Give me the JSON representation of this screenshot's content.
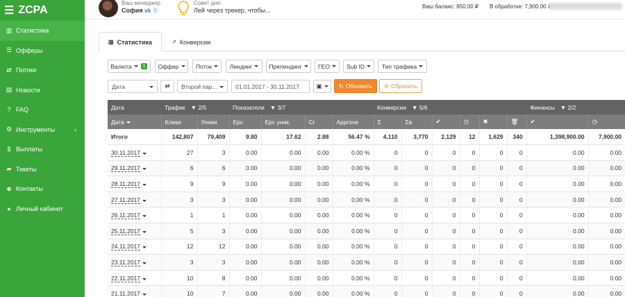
{
  "sidebar": {
    "brand": "ZCPA",
    "items": [
      {
        "label": "Статистика",
        "icon": "bar-chart-icon"
      },
      {
        "label": "Офферы",
        "icon": "list-icon"
      },
      {
        "label": "Потоки",
        "icon": "exchange-icon"
      },
      {
        "label": "Новости",
        "icon": "newspaper-icon"
      },
      {
        "label": "FAQ",
        "icon": "question-icon"
      },
      {
        "label": "Инструменты",
        "icon": "gear-icon"
      },
      {
        "label": "Выплаты",
        "icon": "dollar-icon"
      },
      {
        "label": "Тикеты",
        "icon": "ticket-icon"
      },
      {
        "label": "Контакты",
        "icon": "users-icon"
      },
      {
        "label": "Личный кабинет",
        "icon": "user-icon"
      }
    ]
  },
  "header": {
    "manager_label": "Ваш менеджер",
    "manager_name": "София",
    "advice_label": "Совет дня:",
    "advice_text": "Лей через трекер, чтобы...",
    "balance": "Ваш баланс: 650.00 ₽",
    "processing": "В обработке: 7,900.00 ₽"
  },
  "tabs": [
    {
      "label": "Статистика"
    },
    {
      "label": "Конверсии"
    }
  ],
  "filters": {
    "currency": "Валюта",
    "currency_badge": "1",
    "offer": "Оффер",
    "flows": "Поток",
    "landing": "Лендинг",
    "prelanding": "Прелендинг",
    "geo": "ГЕО",
    "subid": "Sub ID",
    "traffic_type": "Тип трафика",
    "group_primary": "Дата",
    "group_secondary": "Второй пар...",
    "date_range": "01.01.2017 - 30.11.2017",
    "update": "Обновить",
    "reset": "Сбросить"
  },
  "table": {
    "groups": [
      {
        "label": "Дата",
        "count": ""
      },
      {
        "label": "Трафик",
        "count": "2/5"
      },
      {
        "label": "Показатели",
        "count": "3/7"
      },
      {
        "label": "Конверсии",
        "count": "5/6"
      },
      {
        "label": "Финансы",
        "count": "2/2"
      }
    ],
    "columns": [
      "Дата",
      "Клики",
      "Уники",
      "Epc",
      "Epc уник.",
      "Cr",
      "Approve",
      "Σ",
      "Σв",
      "",
      "",
      "",
      "",
      "",
      ""
    ],
    "total": [
      "Итого",
      "142,807",
      "79,409",
      "9.80",
      "17.62",
      "2.88",
      "56.47 %",
      "4,110",
      "3,770",
      "2,129",
      "12",
      "1,629",
      "340",
      "1,398,900.00",
      "7,900.00"
    ],
    "rows": [
      [
        "30.11.2017",
        "27",
        "3",
        "0.00",
        "0.00",
        "0.00",
        "0.00 %",
        "0",
        "0",
        "0",
        "0",
        "0",
        "0",
        "0.00",
        "0.00"
      ],
      [
        "29.11.2017",
        "6",
        "6",
        "0.00",
        "0.00",
        "0.00",
        "0.00 %",
        "0",
        "0",
        "0",
        "0",
        "0",
        "0",
        "0.00",
        "0.00"
      ],
      [
        "28.11.2017",
        "9",
        "9",
        "0.00",
        "0.00",
        "0.00",
        "0.00 %",
        "0",
        "0",
        "0",
        "0",
        "0",
        "0",
        "0.00",
        "0.00"
      ],
      [
        "27.11.2017",
        "3",
        "3",
        "0.00",
        "0.00",
        "0.00",
        "0.00 %",
        "0",
        "0",
        "0",
        "0",
        "0",
        "0",
        "0.00",
        "0.00"
      ],
      [
        "26.11.2017",
        "1",
        "1",
        "0.00",
        "0.00",
        "0.00",
        "0.00 %",
        "0",
        "0",
        "0",
        "0",
        "0",
        "0",
        "0.00",
        "0.00"
      ],
      [
        "25.11.2017",
        "5",
        "3",
        "0.00",
        "0.00",
        "0.00",
        "0.00 %",
        "0",
        "0",
        "0",
        "0",
        "0",
        "0",
        "0.00",
        "0.00"
      ],
      [
        "24.11.2017",
        "12",
        "12",
        "0.00",
        "0.00",
        "0.00",
        "0.00 %",
        "0",
        "0",
        "0",
        "0",
        "0",
        "0",
        "0.00",
        "0.00"
      ],
      [
        "23.11.2017",
        "3",
        "3",
        "0.00",
        "0.00",
        "0.00",
        "0.00 %",
        "0",
        "0",
        "0",
        "0",
        "0",
        "0",
        "0.00",
        "0.00"
      ],
      [
        "22.11.2017",
        "10",
        "8",
        "0.00",
        "0.00",
        "0.00",
        "0.00 %",
        "0",
        "0",
        "0",
        "0",
        "0",
        "0",
        "0.00",
        "0.00"
      ],
      [
        "21.11.2017",
        "10",
        "7",
        "0.00",
        "0.00",
        "0.00",
        "0.00 %",
        "0",
        "0",
        "0",
        "0",
        "0",
        "0",
        "0.00",
        "0.00"
      ]
    ]
  },
  "colors": {
    "sidebar": "#3aa53a",
    "accent_orange": "#f0882c",
    "table_header": "#636363"
  }
}
